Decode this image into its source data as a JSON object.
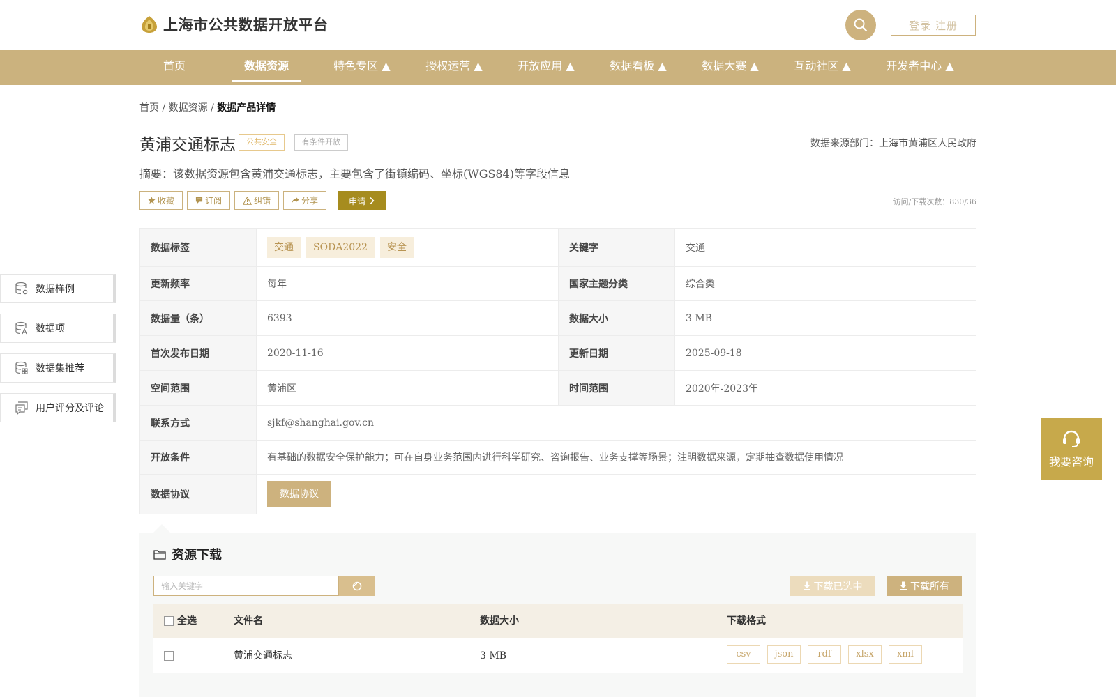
{
  "header": {
    "site_title": "上海市公共数据开放平台",
    "login_label": "登录 注册",
    "brand_color": "#cbb27e"
  },
  "nav": {
    "items": [
      "首页",
      "数据资源",
      "特色专区 ▲",
      "授权运营 ▲",
      "开放应用 ▲",
      "数据看板 ▲",
      "数据大赛 ▲",
      "互动社区 ▲",
      "开发者中心 ▲"
    ],
    "active": "数据资源"
  },
  "breadcrumb": {
    "home": "首页",
    "sep": "/",
    "section": "数据资源",
    "current": "数据产品详情"
  },
  "dataset": {
    "title": "黄浦交通标志",
    "tag_category": "公共安全",
    "tag_open": "有条件开放",
    "source": "数据来源部门：上海市黄浦区人民政府",
    "summary": "摘要：该数据资源包含黄浦交通标志，主要包含了街镇编码、坐标(WGS84)等字段信息",
    "visits": "访问/下载次数：830/36"
  },
  "actions": {
    "favorite": "收藏",
    "subscribe": "订阅",
    "correct": "纠错",
    "share": "分享",
    "apply": "申请"
  },
  "info": {
    "labels": {
      "tags": "数据标签",
      "keyword": "关键字",
      "frequency": "更新频率",
      "theme": "国家主题分类",
      "count": "数据量（条）",
      "size": "数据大小",
      "first_release": "首次发布日期",
      "update_date": "更新日期",
      "space": "空间范围",
      "time": "时间范围",
      "contact": "联系方式",
      "condition": "开放条件",
      "protocol": "数据协议"
    },
    "tags": [
      "交通",
      "SODA2022",
      "安全"
    ],
    "keyword": "交通",
    "frequency": "每年",
    "theme": "综合类",
    "count": "6393",
    "size": "3 MB",
    "first_release": "2020-11-16",
    "update_date": "2025-09-18",
    "space": "黄浦区",
    "time": "2020年-2023年",
    "contact": "sjkf@shanghai.gov.cn",
    "condition": "有基础的数据安全保护能力；可在自身业务范围内进行科学研究、咨询报告、业务支撑等场景；注明数据来源，定期抽查数据使用情况",
    "protocol_button": "数据协议"
  },
  "side_nav": [
    "数据样例",
    "数据项",
    "数据集推荐",
    "用户评分及评论"
  ],
  "consult": {
    "label": "我要咨询"
  },
  "downloads": {
    "heading": "资源下载",
    "search_placeholder": "输入关键字",
    "download_selected": "下载已选中",
    "download_all": "下载所有",
    "columns": {
      "select_all": "全选",
      "filename": "文件名",
      "size": "数据大小",
      "format": "下载格式"
    },
    "rows": [
      {
        "filename": "黄浦交通标志",
        "size": "3 MB",
        "formats": [
          "csv",
          "json",
          "rdf",
          "xlsx",
          "xml"
        ]
      }
    ]
  }
}
